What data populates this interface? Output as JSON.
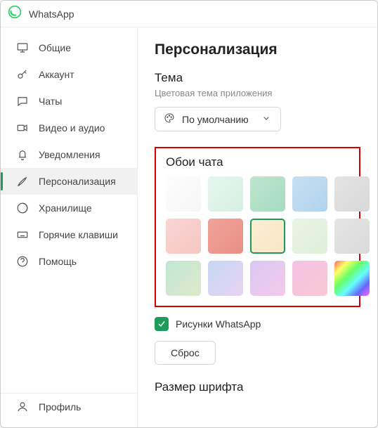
{
  "app": {
    "title": "WhatsApp"
  },
  "sidebar": {
    "items": [
      {
        "label": "Общие"
      },
      {
        "label": "Аккаунт"
      },
      {
        "label": "Чаты"
      },
      {
        "label": "Видео и аудио"
      },
      {
        "label": "Уведомления"
      },
      {
        "label": "Персонализация"
      },
      {
        "label": "Хранилище"
      },
      {
        "label": "Горячие клавиши"
      },
      {
        "label": "Помощь"
      }
    ],
    "profile": {
      "label": "Профиль"
    }
  },
  "settings": {
    "page_title": "Персонализация",
    "theme": {
      "title": "Тема",
      "subtitle": "Цветовая тема приложения",
      "selected": "По умолчанию"
    },
    "wallpaper": {
      "title": "Обои чата",
      "selected_index": 7,
      "swatches": [
        {
          "bg": "linear-gradient(135deg,#fdfdfd,#f6f6f6)"
        },
        {
          "bg": "linear-gradient(135deg,#e6f6ee,#d6f0e3)"
        },
        {
          "bg": "linear-gradient(135deg,#bee5cf,#a5dcbe)"
        },
        {
          "bg": "linear-gradient(135deg,#c6dff3,#b0d3ee)"
        },
        {
          "bg": "linear-gradient(135deg,#e4e4e4,#d8d8d8)"
        },
        {
          "bg": "linear-gradient(135deg,#f9d6d3,#f6c6c2)"
        },
        {
          "bg": "linear-gradient(135deg,#f0a39a,#ea8f85)"
        },
        {
          "bg": "linear-gradient(135deg,#fbeed4,#f9e7c5)"
        },
        {
          "bg": "linear-gradient(135deg,#e9f4e5,#def0d8)"
        },
        {
          "bg": "linear-gradient(135deg,#e5e5e5,#dadada)"
        },
        {
          "bg": "linear-gradient(135deg,#bfe8d5,#e0e9c9)"
        },
        {
          "bg": "linear-gradient(135deg,#c6d6f4,#e8d4f2)"
        },
        {
          "bg": "linear-gradient(135deg,#d9c9f4,#f5c9e8)"
        },
        {
          "bg": "linear-gradient(135deg,#f5c2e5,#f8c8d2)"
        },
        {
          "bg": "linear-gradient(135deg,#f66,#ff6,#6f6,#6ff,#66f,#f6f)"
        }
      ],
      "doodles_label": "Рисунки WhatsApp",
      "doodles_checked": true,
      "reset_label": "Сброс"
    },
    "font": {
      "title": "Размер шрифта"
    }
  }
}
